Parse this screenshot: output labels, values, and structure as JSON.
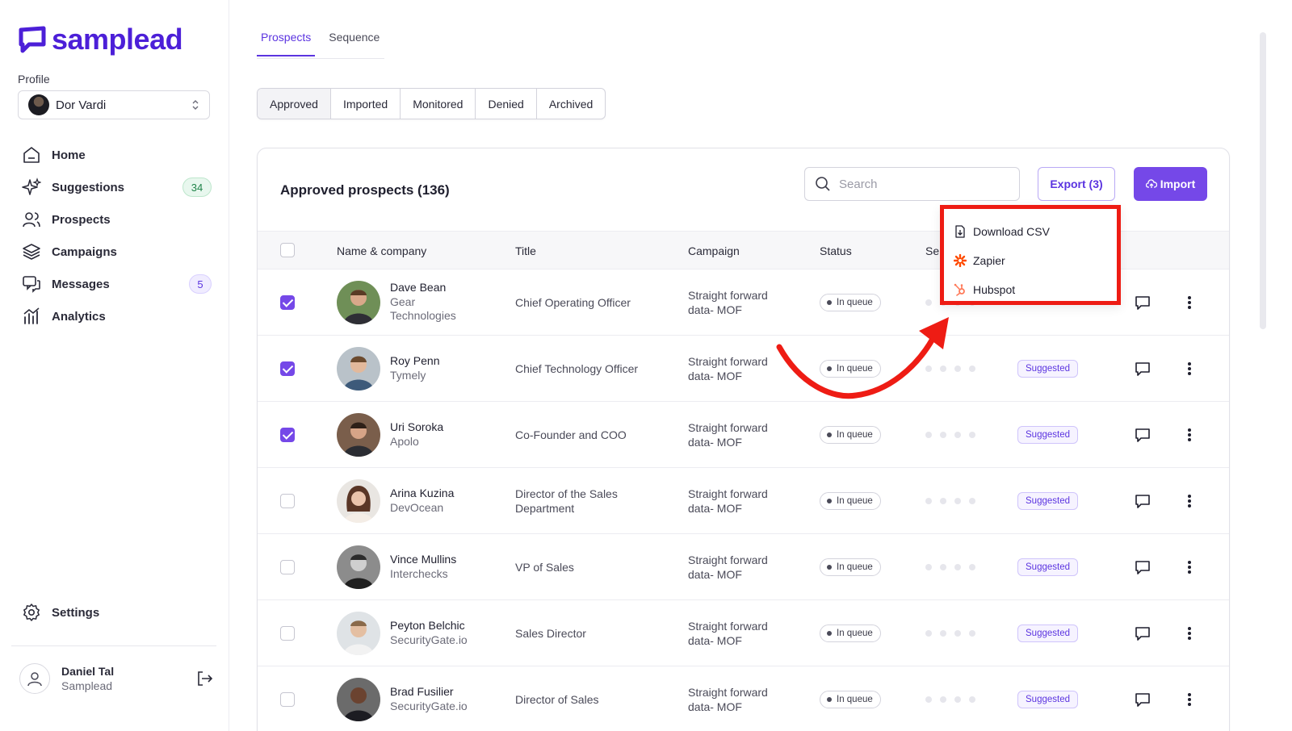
{
  "brand": {
    "name": "samplead",
    "color": "#4c1fd8"
  },
  "profile": {
    "label": "Profile",
    "name": "Dor Vardi"
  },
  "nav": [
    {
      "label": "Home",
      "icon": "home-icon"
    },
    {
      "label": "Suggestions",
      "icon": "sparkles-icon",
      "badge": "34"
    },
    {
      "label": "Prospects",
      "icon": "users-icon"
    },
    {
      "label": "Campaigns",
      "icon": "layers-icon"
    },
    {
      "label": "Messages",
      "icon": "chat-icon",
      "badge": "5"
    },
    {
      "label": "Analytics",
      "icon": "analytics-icon"
    }
  ],
  "settings": {
    "label": "Settings"
  },
  "user": {
    "name": "Daniel Tal",
    "company": "Samplead"
  },
  "top_tabs": [
    {
      "label": "Prospects",
      "active": true
    },
    {
      "label": "Sequence",
      "active": false
    }
  ],
  "filter_tabs": [
    {
      "label": "Approved",
      "active": true
    },
    {
      "label": "Imported"
    },
    {
      "label": "Monitored"
    },
    {
      "label": "Denied"
    },
    {
      "label": "Archived"
    }
  ],
  "card": {
    "title": "Approved prospects (136)",
    "search_placeholder": "Search",
    "export_label": "Export (3)",
    "import_label": "Import"
  },
  "table": {
    "headers": {
      "name": "Name & company",
      "title": "Title",
      "campaign": "Campaign",
      "status": "Status",
      "sequence_partial": "Se"
    },
    "rows": [
      {
        "checked": true,
        "name": "Dave Bean",
        "company": "Gear Technologies",
        "title": "Chief Operating Officer",
        "campaign": "Straight forward data- MOF",
        "status": "In queue",
        "suggested": ""
      },
      {
        "checked": true,
        "name": "Roy Penn",
        "company": "Tymely",
        "title": "Chief Technology Officer",
        "campaign": "Straight forward data- MOF",
        "status": "In queue",
        "suggested": "Suggested"
      },
      {
        "checked": true,
        "name": "Uri Soroka",
        "company": "Apolo",
        "title": "Co-Founder and COO",
        "campaign": "Straight forward data- MOF",
        "status": "In queue",
        "suggested": "Suggested"
      },
      {
        "checked": false,
        "name": "Arina Kuzina",
        "company": "DevOcean",
        "title": "Director of the Sales Department",
        "campaign": "Straight forward data- MOF",
        "status": "In queue",
        "suggested": "Suggested"
      },
      {
        "checked": false,
        "name": "Vince Mullins",
        "company": "Interchecks",
        "title": "VP of Sales",
        "campaign": "Straight forward data- MOF",
        "status": "In queue",
        "suggested": "Suggested"
      },
      {
        "checked": false,
        "name": "Peyton Belchic",
        "company": "SecurityGate.io",
        "title": "Sales Director",
        "campaign": "Straight forward data- MOF",
        "status": "In queue",
        "suggested": "Suggested"
      },
      {
        "checked": false,
        "name": "Brad Fusilier",
        "company": "SecurityGate.io",
        "title": "Director of Sales",
        "campaign": "Straight forward data- MOF",
        "status": "In queue",
        "suggested": "Suggested"
      }
    ]
  },
  "export_menu": [
    {
      "label": "Download CSV",
      "icon": "download-file-icon"
    },
    {
      "label": "Zapier",
      "icon": "zapier-icon",
      "color": "#ff4a00"
    },
    {
      "label": "Hubspot",
      "icon": "hubspot-icon",
      "color": "#ff7a59"
    }
  ],
  "colors": {
    "accent": "#7548e8",
    "highlight": "#ee1c14"
  }
}
